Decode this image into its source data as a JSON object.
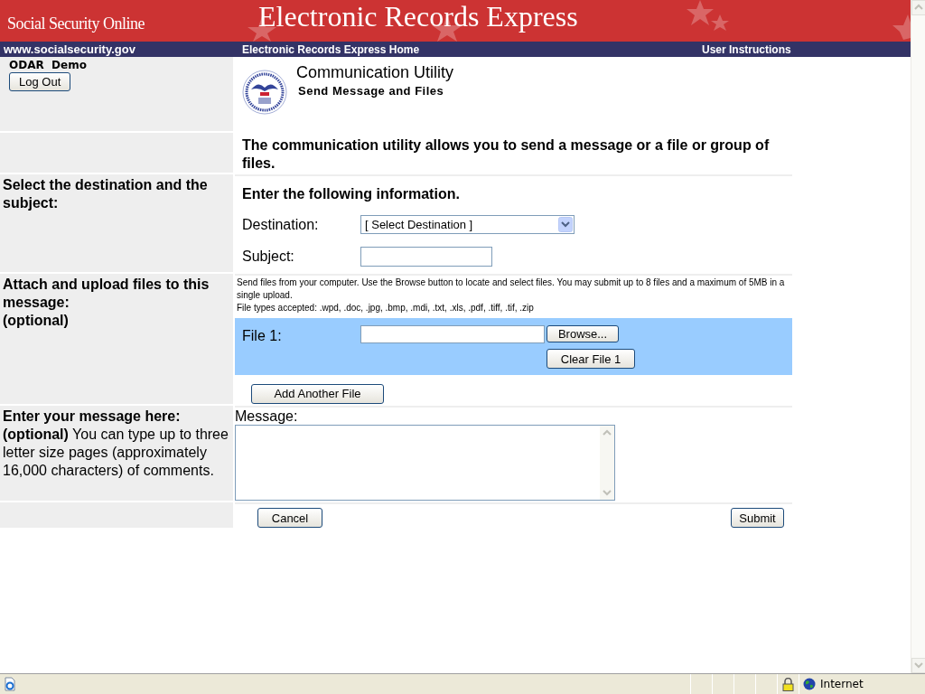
{
  "header": {
    "site": "Social Security Online",
    "title": "Electronic Records Express"
  },
  "nav": {
    "left": "www.socialsecurity.gov",
    "center": "Electronic Records Express Home",
    "right": "User Instructions"
  },
  "user": {
    "name": "ODAR  Demo",
    "logout": "Log Out"
  },
  "heading": {
    "title": "Communication Utility",
    "subtitle": "Send Message and Files"
  },
  "intro": "The communication utility allows you to send a message or a file or group of files.",
  "destination": {
    "label": "Select the destination and the subject:",
    "heading": "Enter the following information.",
    "fields": [
      {
        "kind": "select",
        "label": "Destination:",
        "value": "[ Select Destination ]"
      },
      {
        "kind": "text",
        "label": "Subject:"
      }
    ]
  },
  "attach": {
    "label": "Attach and upload files to this message:",
    "optional": "(optional)",
    "instructions": "Send files from your computer. Use the Browse button to locate and select files. You may submit up to 8 files and a maximum of 5MB in a single upload.",
    "file_types": "File types accepted: .wpd, .doc, .jpg, .bmp, .mdi, .txt, .xls, .pdf, .tiff, .tif, .zip",
    "files": [
      {
        "label": "File 1:",
        "browse": "Browse...",
        "clear": "Clear File 1"
      }
    ],
    "add_button": "Add Another File"
  },
  "message": {
    "label": "Enter your message here:",
    "note": "**(optional)** You can type up to three letter size pages (approximately 16,000 characters) of comments.",
    "field_label": "Message:"
  },
  "actions": {
    "cancel": "Cancel",
    "submit": "Submit"
  },
  "status_bar": {
    "zone": "Internet"
  }
}
